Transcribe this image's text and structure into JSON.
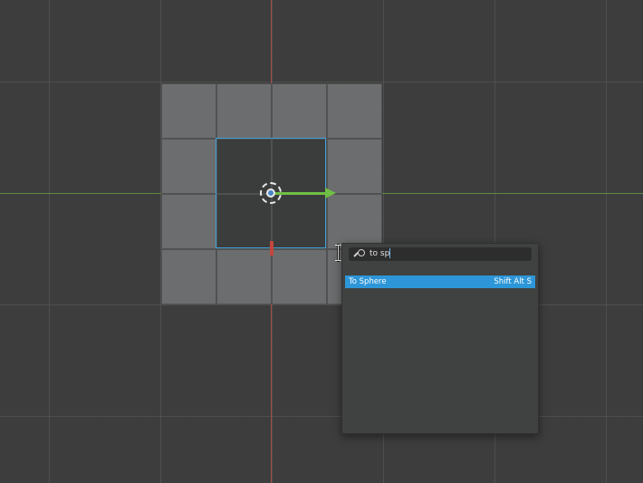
{
  "search": {
    "query": "to sp"
  },
  "results": [
    {
      "label": "To Sphere",
      "shortcut": "Shift Alt S"
    }
  ],
  "colors": {
    "background": "#3d3d3d",
    "mesh_face": "#6c6d6e",
    "selection": "#3fa0d8",
    "highlight": "#2d96d8",
    "axis_x": "#c5463d",
    "axis_y": "#6fbf45"
  },
  "icons": [
    "search-icon",
    "pivot-icon",
    "text-cursor-icon"
  ]
}
